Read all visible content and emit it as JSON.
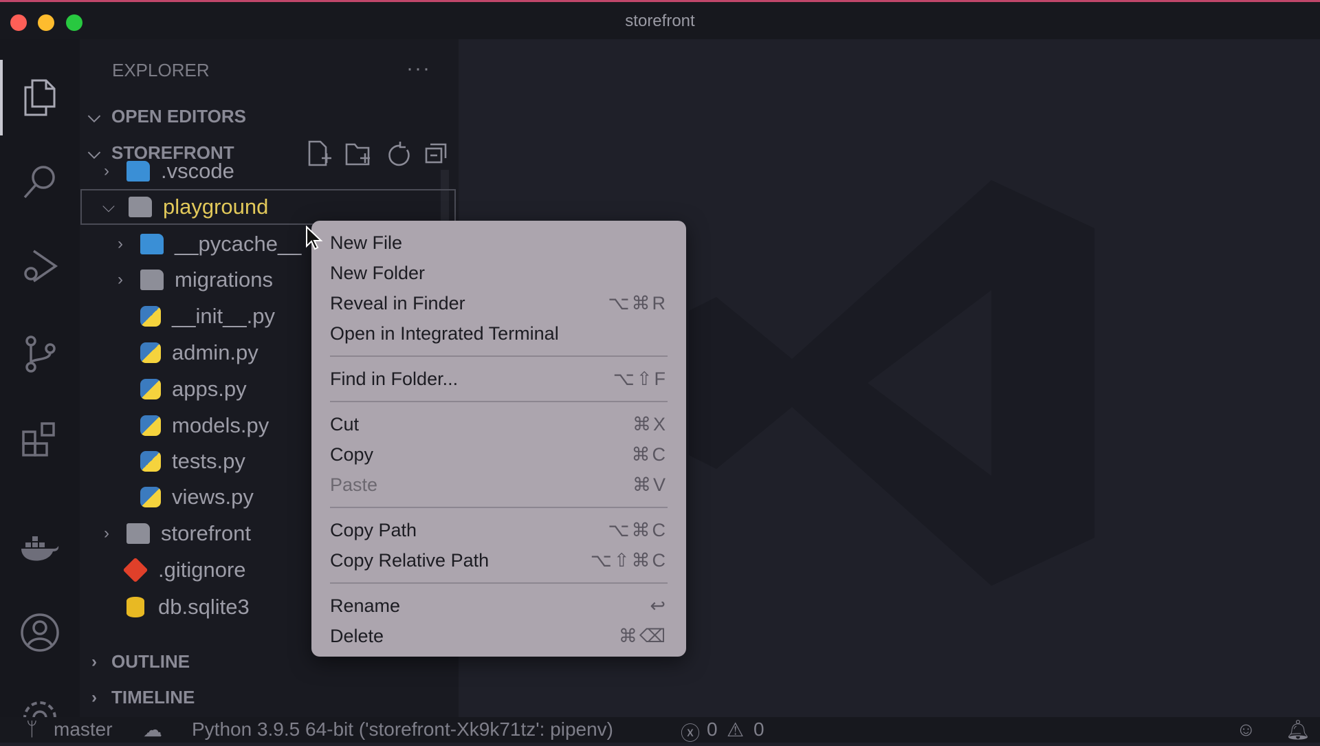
{
  "window": {
    "title": "storefront"
  },
  "explorer": {
    "header": "EXPLORER",
    "more": "···",
    "open_editors": "OPEN EDITORS",
    "root": "STOREFRONT",
    "outline": "OUTLINE",
    "timeline": "TIMELINE",
    "tree": [
      {
        "name": ".vscode",
        "type": "folder",
        "expanded": false,
        "depth": 0
      },
      {
        "name": "playground",
        "type": "folder",
        "expanded": true,
        "depth": 0,
        "selected": true
      },
      {
        "name": "__pycache__",
        "type": "folder",
        "expanded": false,
        "depth": 1
      },
      {
        "name": "migrations",
        "type": "folder",
        "expanded": false,
        "depth": 1
      },
      {
        "name": "__init__.py",
        "type": "python",
        "depth": 1
      },
      {
        "name": "admin.py",
        "type": "python",
        "depth": 1
      },
      {
        "name": "apps.py",
        "type": "python",
        "depth": 1
      },
      {
        "name": "models.py",
        "type": "python",
        "depth": 1
      },
      {
        "name": "tests.py",
        "type": "python",
        "depth": 1
      },
      {
        "name": "views.py",
        "type": "python",
        "depth": 1
      },
      {
        "name": "storefront",
        "type": "folder",
        "expanded": false,
        "depth": 0
      },
      {
        "name": ".gitignore",
        "type": "git",
        "depth": 0
      },
      {
        "name": "db.sqlite3",
        "type": "database",
        "depth": 0
      }
    ]
  },
  "context_menu": {
    "items": [
      {
        "label": "New File",
        "shortcut": ""
      },
      {
        "label": "New Folder",
        "shortcut": ""
      },
      {
        "label": "Reveal in Finder",
        "shortcut": "⌥⌘R"
      },
      {
        "label": "Open in Integrated Terminal",
        "shortcut": ""
      },
      {
        "label": "Find in Folder...",
        "shortcut": "⌥⇧F"
      },
      {
        "label": "Cut",
        "shortcut": "⌘X"
      },
      {
        "label": "Copy",
        "shortcut": "⌘C"
      },
      {
        "label": "Paste",
        "shortcut": "⌘V",
        "disabled": true
      },
      {
        "label": "Copy Path",
        "shortcut": "⌥⌘C"
      },
      {
        "label": "Copy Relative Path",
        "shortcut": "⌥⇧⌘C"
      },
      {
        "label": "Rename",
        "shortcut": "↩"
      },
      {
        "label": "Delete",
        "shortcut": "⌘⌫"
      }
    ]
  },
  "status": {
    "branch": "master",
    "interpreter": "Python 3.9.5 64-bit ('storefront-Xk9k71tz': pipenv)",
    "errors": "0",
    "warnings": "0"
  },
  "colors": {
    "selected_folder": "#e2c95a",
    "python_blue": "#3b7bbf",
    "python_yellow": "#f5d33d",
    "git": "#e0402a",
    "db": "#e8b923"
  }
}
